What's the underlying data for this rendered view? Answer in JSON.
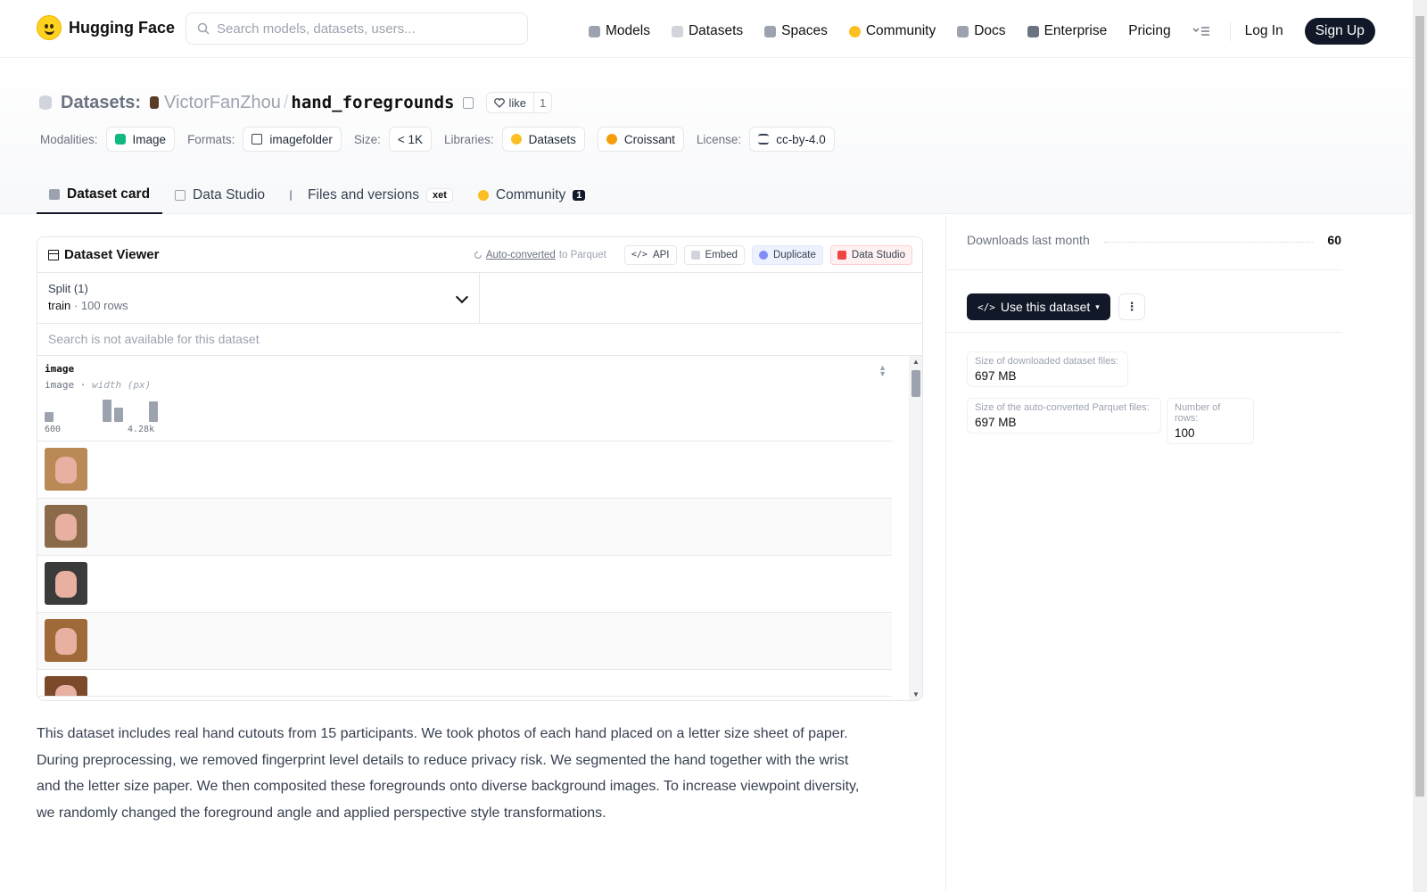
{
  "header": {
    "brand": "Hugging Face",
    "search_placeholder": "Search models, datasets, users...",
    "nav": [
      {
        "label": "Models",
        "color": "#9ca3af"
      },
      {
        "label": "Datasets",
        "color": "#d1d5db"
      },
      {
        "label": "Spaces",
        "color": "#9ca3af"
      },
      {
        "label": "Community",
        "color": "#fbbf24"
      },
      {
        "label": "Docs",
        "color": "#9ca3af"
      },
      {
        "label": "Enterprise",
        "color": "#6b7280"
      },
      {
        "label": "Pricing",
        "color": ""
      }
    ],
    "login": "Log In",
    "signup": "Sign Up"
  },
  "repo": {
    "crumb_label": "Datasets:",
    "owner": "VictorFanZhou",
    "separator": "/",
    "name": "hand_foregrounds",
    "like_label": "like",
    "like_count": "1"
  },
  "meta": {
    "modalities_label": "Modalities:",
    "modality": "Image",
    "formats_label": "Formats:",
    "format": "imagefolder",
    "size_label": "Size:",
    "size": "< 1K",
    "libraries_label": "Libraries:",
    "libraries": [
      "Datasets",
      "Croissant"
    ],
    "license_label": "License:",
    "license": "cc-by-4.0"
  },
  "tabs": [
    {
      "label": "Dataset card",
      "active": true
    },
    {
      "label": "Data Studio"
    },
    {
      "label": "Files and versions",
      "badge": "xet"
    },
    {
      "label": "Community",
      "count": "1"
    }
  ],
  "viewer": {
    "title": "Dataset Viewer",
    "auto_converted": "Auto-converted",
    "to_parquet": "to Parquet",
    "buttons": [
      "API",
      "Embed",
      "Duplicate",
      "Data Studio"
    ],
    "split_label": "Split (1)",
    "split_name": "train",
    "split_rows": "100 rows",
    "search_na": "Search is not available for this dataset",
    "column": {
      "name": "image",
      "type": "image",
      "subtype": "width (px)",
      "hist_min": "600",
      "hist_max": "4.28k"
    },
    "rows": [
      {
        "bg": "#b98a55"
      },
      {
        "bg": "#8a6a48"
      },
      {
        "bg": "#3b3b3b"
      },
      {
        "bg": "#a06a38"
      },
      {
        "bg": "#7a4a2a"
      }
    ]
  },
  "description": "This dataset includes real hand cutouts from 15 participants. We took photos of each hand placed on a letter size sheet of paper. During preprocessing, we removed fingerprint level details to reduce privacy risk. We segmented the hand together with the wrist and the letter size paper. We then composited these foregrounds onto diverse background images. To increase viewpoint diversity, we randomly changed the foreground angle and applied perspective style transformations.",
  "sidebar": {
    "downloads_label": "Downloads last month",
    "downloads_value": "60",
    "use_button": "Use this dataset",
    "stats": [
      {
        "label": "Size of downloaded dataset files:",
        "value": "697 MB"
      },
      {
        "label": "Size of the auto-converted Parquet files:",
        "value": "697 MB"
      },
      {
        "label": "Number of rows:",
        "value": "100"
      }
    ]
  }
}
